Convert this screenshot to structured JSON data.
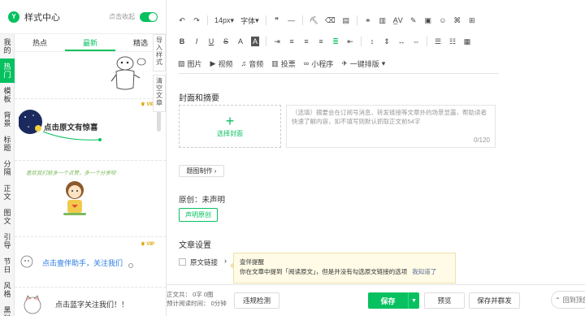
{
  "sidebar": {
    "title": "样式中心",
    "collapse_label": "点击收起",
    "vertical_tabs": [
      {
        "label": "我的"
      },
      {
        "label": "热门",
        "active": true
      },
      {
        "label": "模板"
      },
      {
        "label": "背景"
      },
      {
        "label": "标题"
      },
      {
        "label": "分隔"
      },
      {
        "label": "正文"
      },
      {
        "label": "图文"
      },
      {
        "label": "引导"
      },
      {
        "label": "节日"
      },
      {
        "label": "风格"
      },
      {
        "label": "黑科"
      }
    ],
    "tabs": [
      {
        "label": "热点"
      },
      {
        "label": "最新",
        "active": true
      },
      {
        "label": "精选"
      }
    ],
    "cards": [
      {
        "text": ""
      },
      {
        "text": "点击原文有惊喜",
        "vip": "VIP"
      },
      {
        "text": "喜欢我们就多一个点赞，多一个分享呗"
      },
      {
        "text": "点击壹伴助手，关注我们",
        "vip": "VIP"
      },
      {
        "text": "点击蓝字关注我们！！"
      }
    ],
    "side_tools": [
      {
        "label": "导入样式"
      },
      {
        "label": "清空文章"
      }
    ]
  },
  "toolbar": {
    "font_size": "14px",
    "font_family": "字体",
    "insert_items": [
      {
        "label": "图片",
        "icon": "image-icon"
      },
      {
        "label": "视频",
        "icon": "video-icon"
      },
      {
        "label": "音频",
        "icon": "audio-icon"
      },
      {
        "label": "投票",
        "icon": "poll-icon"
      },
      {
        "label": "小程序",
        "icon": "miniprogram-icon"
      },
      {
        "label": "一键排版",
        "icon": "layout-icon"
      }
    ]
  },
  "cover": {
    "section_title": "封面和摘要",
    "choose_cover": "选择封面",
    "summary_placeholder": "（选填）摘要会在订阅号消息、转发链接等文章外的场景显露，帮助读者快速了解内容，如不填写则默认抓取正文前54字",
    "summary_count": "0/120"
  },
  "title_image_button": "题图制作",
  "original": {
    "label": "原创：未声明",
    "button": "声明原创"
  },
  "settings": {
    "title": "文章设置",
    "original_link_label": "原文链接"
  },
  "tooltip": {
    "title": "壹伴提醒",
    "message": "你在文章中提到「阅读原文」，但是并没有勾选原文链接的选项",
    "action": "我知道了"
  },
  "footer": {
    "word_count_label": "正文共：",
    "word_count_value": "0字 0图",
    "read_time_label": "预计阅读时间：",
    "read_time_value": "0分钟",
    "check_button": "违规检测",
    "save_button": "保存",
    "preview_button": "预览",
    "save_publish_button": "保存并群发",
    "back_top": "回到顶部"
  },
  "colors": {
    "accent": "#07c160",
    "vip": "#d9a300",
    "link": "#576b95"
  }
}
